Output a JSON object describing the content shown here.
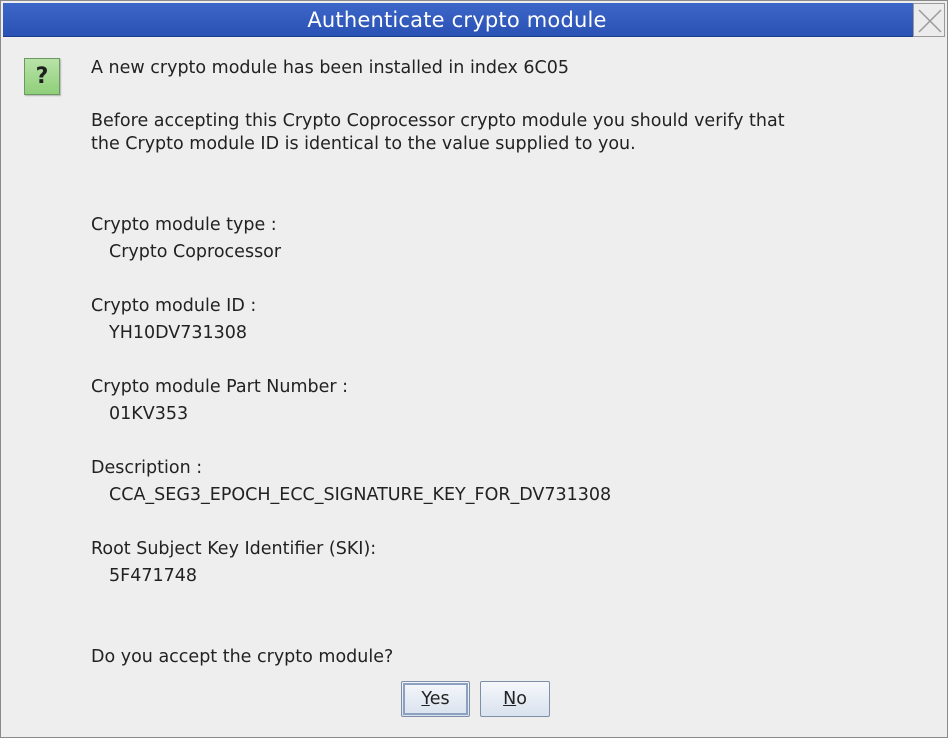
{
  "window": {
    "title": "Authenticate crypto module"
  },
  "dialog": {
    "icon": "question-icon",
    "icon_glyph": "?",
    "intro": "A new crypto module has been installed in index 6C05",
    "instruction_line1": "Before accepting this Crypto Coprocessor crypto module you should verify that",
    "instruction_line2": "the Crypto module ID is identical to the value supplied to you.",
    "fields": [
      {
        "label": "Crypto module type :",
        "value": "Crypto Coprocessor"
      },
      {
        "label": "Crypto module ID :",
        "value": "YH10DV731308"
      },
      {
        "label": "Crypto module Part Number :",
        "value": "01KV353"
      },
      {
        "label": "Description :",
        "value": "CCA_SEG3_EPOCH_ECC_SIGNATURE_KEY_FOR_DV731308"
      },
      {
        "label": "Root Subject Key Identifier (SKI):",
        "value": "5F471748"
      }
    ],
    "question": "Do you accept the crypto module?"
  },
  "buttons": {
    "yes_first": "Y",
    "yes_rest": "es",
    "no_first": "N",
    "no_rest": "o"
  },
  "colors": {
    "titlebar": "#2f5abf",
    "dialog_bg": "#eeeeee",
    "icon_green": "#a4d993"
  }
}
